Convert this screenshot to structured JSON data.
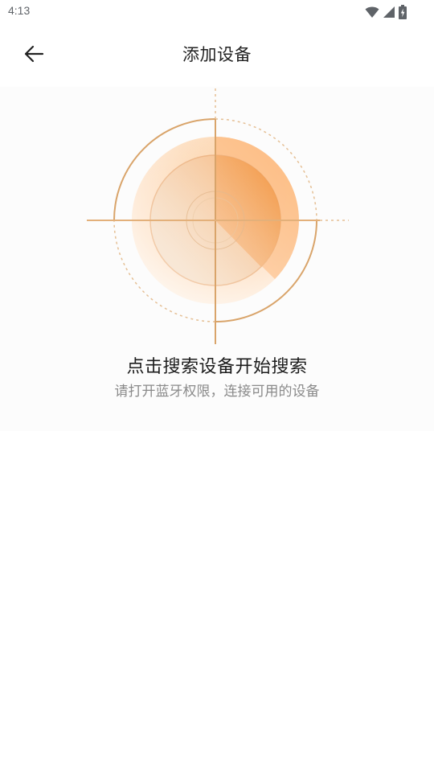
{
  "status_bar": {
    "time": "4:13",
    "icons": [
      "wifi-icon",
      "cellular-signal-icon",
      "battery-charging-icon"
    ]
  },
  "header": {
    "back_icon": "arrow-left-icon",
    "title": "添加设备"
  },
  "scan": {
    "title": "点击搜索设备开始搜索",
    "subtitle": "请打开蓝牙权限，连接可用的设备"
  },
  "colors": {
    "accent": "#f0923a",
    "ring": "#d9a46a",
    "panel_bg": "#fcfcfc"
  }
}
